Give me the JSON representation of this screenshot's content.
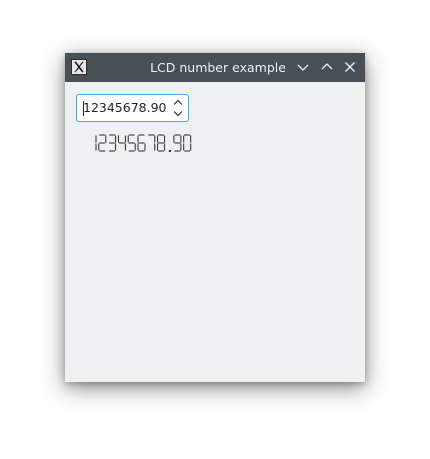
{
  "window": {
    "title": "LCD number example",
    "icon": "x-app-icon"
  },
  "titlebar_buttons": [
    {
      "name": "minimize-button",
      "icon": "chevron-down-icon"
    },
    {
      "name": "maximize-button",
      "icon": "chevron-up-icon"
    },
    {
      "name": "close-button",
      "icon": "close-icon"
    }
  ],
  "spinbox": {
    "value": "12345678.90"
  },
  "lcd": {
    "display": "12345678.90",
    "color": "#232627"
  },
  "colors": {
    "titlebar": "#475057",
    "window_bg": "#eff0f1",
    "focus_border": "#3daee9"
  }
}
